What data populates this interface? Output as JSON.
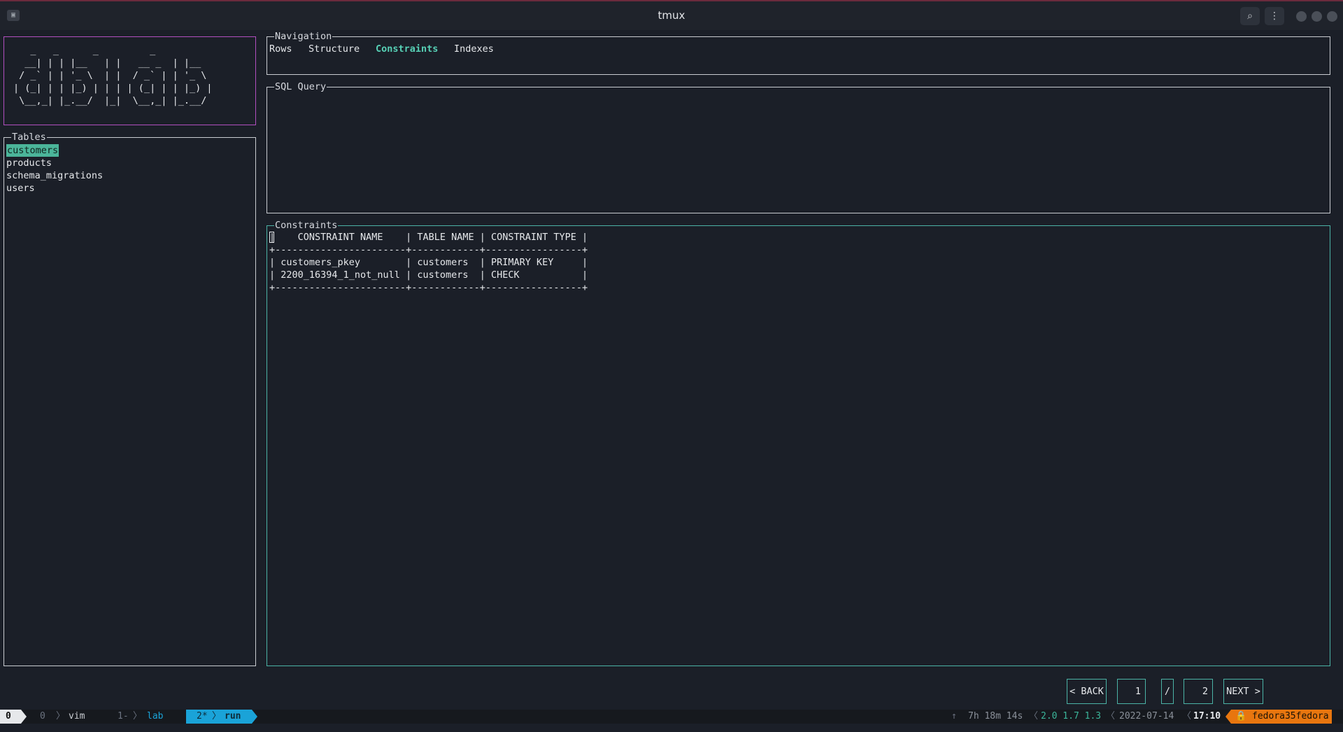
{
  "window": {
    "title": "tmux",
    "icons": [
      "terminal-icon",
      "search-icon",
      "kebab-menu-icon"
    ]
  },
  "logo": {
    "art": "   _   _      _         _\n  __| | | |__   | |   __ _  | |__\n / _` | | '_ \\  | |  / _` | | '_ \\\n| (_| | | |_) | | | | (_| | | |_) |\n \\__,_| |_.__/  |_|  \\__,_| |_.__/"
  },
  "tables": {
    "title": "Tables",
    "items": [
      "customers",
      "products",
      "schema_migrations",
      "users"
    ],
    "selected": "customers"
  },
  "navigation": {
    "title": "Navigation",
    "tabs": [
      "Rows",
      "Structure",
      "Constraints",
      "Indexes"
    ],
    "active": "Constraints"
  },
  "sql_query": {
    "title": "SQL Query",
    "value": ""
  },
  "constraints": {
    "title": "Constraints",
    "columns": [
      "CONSTRAINT NAME",
      "TABLE NAME",
      "CONSTRAINT TYPE"
    ],
    "rows": [
      [
        "customers_pkey",
        "customers",
        "PRIMARY KEY"
      ],
      [
        "2200_16394_1_not_null",
        "customers",
        "CHECK"
      ]
    ],
    "text": "|    CONSTRAINT NAME    | TABLE NAME | CONSTRAINT TYPE |\n+-----------------------+------------+-----------------+\n| customers_pkey        | customers  | PRIMARY KEY     |\n| 2200_16394_1_not_null | customers  | CHECK           |\n+-----------------------+------------+-----------------+"
  },
  "pagination": {
    "back_label": "< BACK",
    "current_page": "1",
    "separator": "/",
    "total_pages": "2",
    "next_label": "NEXT >"
  },
  "statusbar": {
    "session": "0",
    "windows": [
      {
        "index": "0",
        "name": "vim"
      },
      {
        "index": "1-",
        "name": "lab"
      },
      {
        "index": "2*",
        "name": "run"
      }
    ],
    "uptime_arrow": "↑",
    "uptime": "7h 18m 14s",
    "load": "2.0 1.7 1.3",
    "date": "2022-07-14",
    "time": "17:10",
    "host": "🔒 fedora35fedora",
    "colors": {
      "bar_bg": "#16191e",
      "active_window": "#1aa3d8",
      "load": "#3bb59a",
      "host": "#e8760f"
    }
  }
}
